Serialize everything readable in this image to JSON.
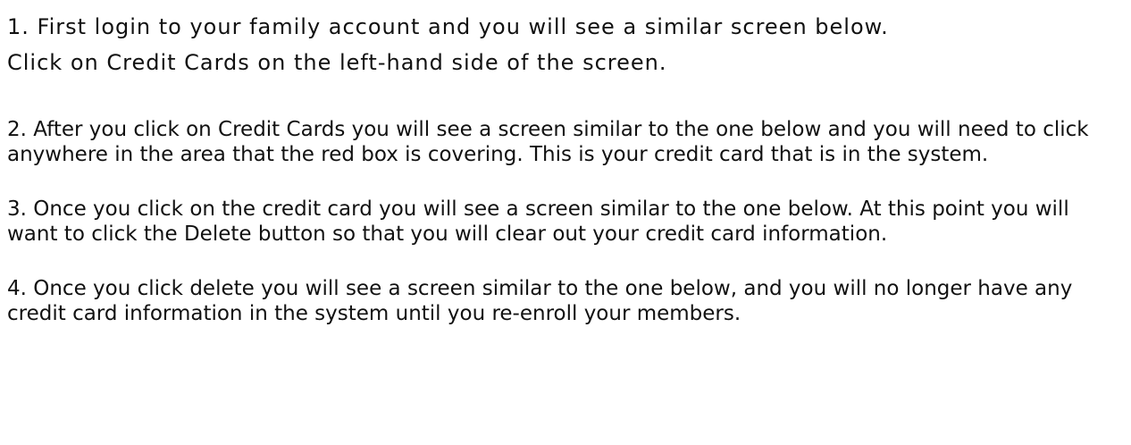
{
  "instructions": {
    "step1": {
      "line1": "1. First login to your family account and you will see a similar screen below.",
      "line2": "Click on Credit Cards on the left-hand side of the screen."
    },
    "step2": "2. After you click on Credit Cards you will see a screen similar to the one below and you will need to click anywhere in the area that the red box is covering. This is your credit card that is in the system.",
    "step3": "3. Once you click on the credit card you will see a screen similar to the one below. At this point you will want to click the Delete button so that you will clear out your credit card information.",
    "step4": "4. Once you click delete you will see a screen similar to the one below, and you will no longer have any credit card information in the system until you re-enroll your members."
  }
}
